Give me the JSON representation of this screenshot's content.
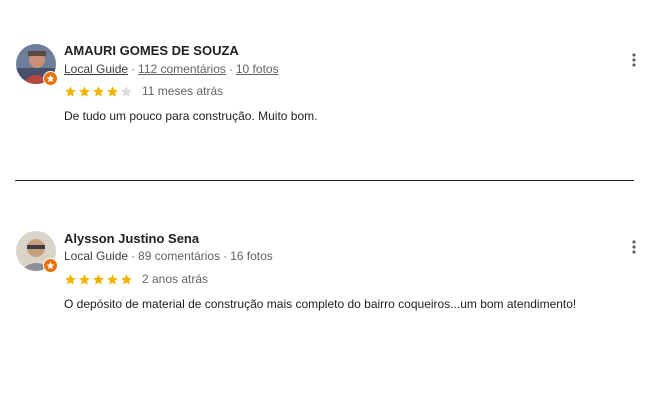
{
  "colors": {
    "star_filled": "#f4b400",
    "star_empty": "#dadce0",
    "local_guide_badge": "#e8710a"
  },
  "reviews": [
    {
      "name": "AMAURI GOMES DE SOUZA",
      "guide_label": "Local Guide",
      "comments": "112 comentários",
      "photos": "10 fotos",
      "rating": 4,
      "time": "11 meses atrás",
      "text": "De tudo um pouco para construção. Muito bom.",
      "icons": {
        "avatar": "avatar-photo",
        "badge": "local-guide-star-icon",
        "more": "more-vert-icon"
      }
    },
    {
      "name": "Alysson Justino Sena",
      "guide_label": "Local Guide",
      "comments": "89 comentários",
      "photos": "16 fotos",
      "rating": 5,
      "time": "2 anos atrás",
      "text": "O depósito de material de construção mais completo do bairro coqueiros...um bom atendimento!",
      "icons": {
        "avatar": "avatar-photo",
        "badge": "local-guide-star-icon",
        "more": "more-vert-icon"
      }
    }
  ]
}
